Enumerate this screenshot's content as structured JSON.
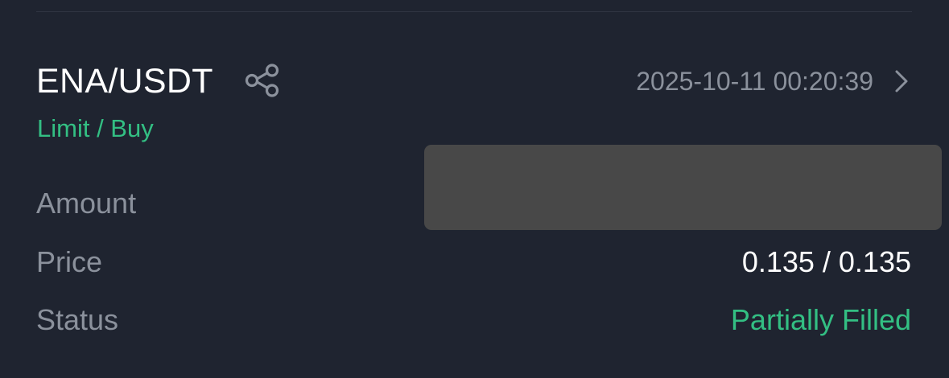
{
  "order": {
    "pair": "ENA/USDT",
    "timestamp": "2025-10-11 00:20:39",
    "order_type": "Limit / Buy",
    "rows": [
      {
        "label": "Amount",
        "value": ""
      },
      {
        "label": "Price",
        "value": "0.135 / 0.135"
      },
      {
        "label": "Status",
        "value": "Partially Filled"
      }
    ]
  },
  "icons": {
    "share": "share-icon",
    "chevron": "chevron-right-icon"
  },
  "colors": {
    "background": "#1f2430",
    "primary_text": "#ffffff",
    "secondary_text": "#8b919c",
    "accent_green": "#33bf83",
    "redaction": "#484848",
    "divider": "#2f3542"
  }
}
